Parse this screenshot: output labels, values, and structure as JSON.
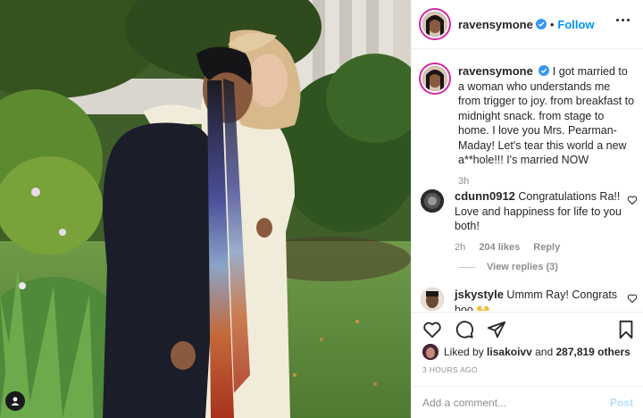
{
  "header": {
    "username": "ravensymone",
    "dot": "•",
    "follow_label": "Follow",
    "more_icon": "more-dots-icon",
    "verified_icon": "verified-badge-icon"
  },
  "caption": {
    "username": "ravensymone",
    "text": "I got married to a woman who understands me from trigger to joy. from breakfast to midnight snack. from stage to home. I love you Mrs. Pearman-Maday! Let's tear this world a new a**hole!!! I's married NOW",
    "time": "3h"
  },
  "comments": [
    {
      "username": "cdunn0912",
      "text": "Congratulations Ra!! Love and happiness for life to you both!",
      "time": "2h",
      "likes": "204 likes",
      "reply": "Reply",
      "view_replies": "View replies (3)"
    },
    {
      "username": "jskystyle",
      "text": "Ummm Ray! Congrats boo 🙌"
    }
  ],
  "actions": {
    "icons": [
      "heart-icon",
      "comment-icon",
      "share-icon",
      "bookmark-icon"
    ],
    "liked_by_prefix": "Liked by",
    "liked_by_user": "lisakoivv",
    "liked_by_and": "and",
    "liked_by_count": "287,819 others",
    "timestamp": "3 HOURS AGO"
  },
  "add_comment": {
    "placeholder": "Add a comment...",
    "post_label": "Post"
  },
  "colors": {
    "link_blue": "#0095f6",
    "post_disabled": "#b2dffc",
    "muted": "#8e8e8e",
    "text": "#262626"
  }
}
